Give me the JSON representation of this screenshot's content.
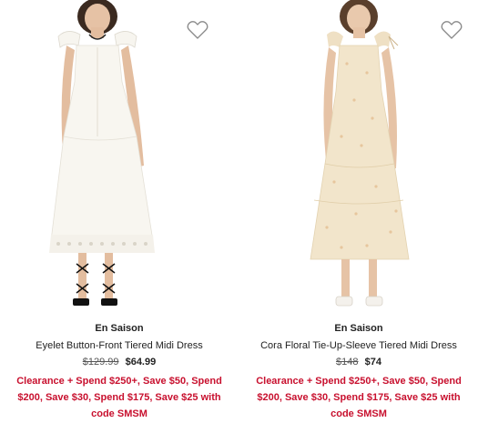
{
  "products": [
    {
      "brand": "En Saison",
      "title": "Eyelet Button-Front Tiered Midi Dress",
      "price_original": "$129.99",
      "price_sale": "$64.99",
      "promo_lines": [
        "Clearance + Spend $250+, Save $50, Spend",
        "$200, Save $30, Spend $175, Save $25 with",
        "code SMSM"
      ],
      "image_icon": "dress-photo-white-eyelet",
      "wishlist_icon": "heart-outline-icon"
    },
    {
      "brand": "En Saison",
      "title": "Cora Floral Tie-Up-Sleeve Tiered Midi Dress",
      "price_original": "$148",
      "price_sale": "$74",
      "promo_lines": [
        "Clearance + Spend $250+, Save $50, Spend",
        "$200, Save $30, Spend $175, Save $25 with",
        "code SMSM"
      ],
      "image_icon": "dress-photo-floral-peach",
      "wishlist_icon": "heart-outline-icon"
    }
  ],
  "colors": {
    "promo": "#c8102e",
    "text": "#222222",
    "strike": "#555555"
  }
}
